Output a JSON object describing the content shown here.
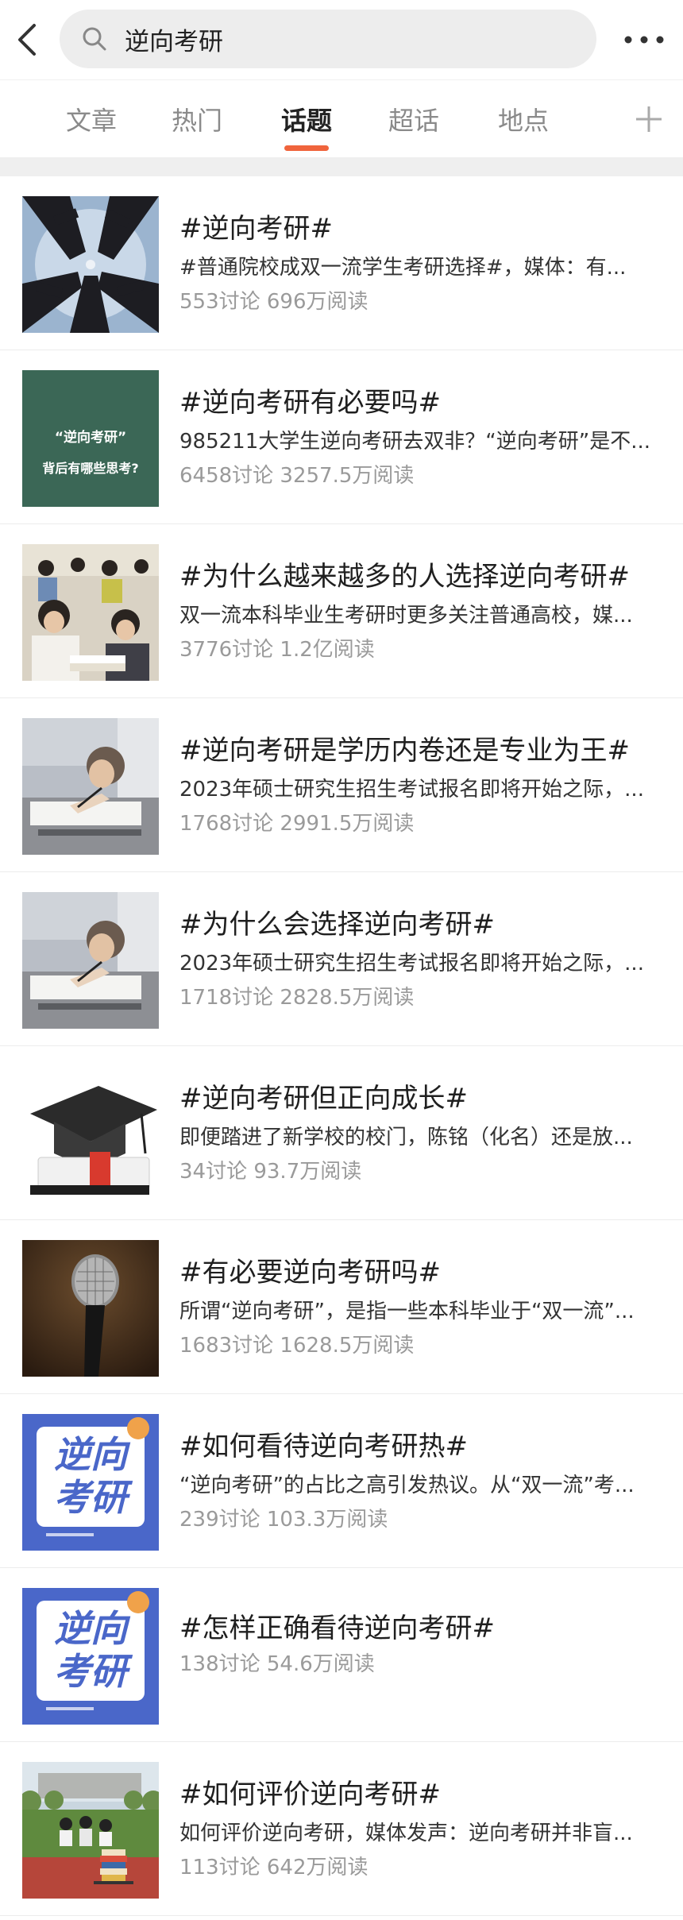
{
  "search": {
    "query": "逆向考研"
  },
  "tabs": [
    {
      "label": "文章"
    },
    {
      "label": "热门"
    },
    {
      "label": "话题"
    },
    {
      "label": "超话"
    },
    {
      "label": "地点"
    }
  ],
  "topics": [
    {
      "title": "#逆向考研#",
      "desc": "#普通院校成双一流学生考研选择#，媒体：有...",
      "meta": "553讨论 696万阅读"
    },
    {
      "title": "#逆向考研有必要吗#",
      "desc": "985211大学生逆向考研去双非？“逆向考研”是不...",
      "meta": "6458讨论 3257.5万阅读",
      "thumb_text": [
        "“逆向考研”",
        "背后有哪些思考?"
      ]
    },
    {
      "title": "#为什么越来越多的人选择逆向考研#",
      "desc": "双一流本科毕业生考研时更多关注普通高校，媒...",
      "meta": "3776讨论 1.2亿阅读"
    },
    {
      "title": "#逆向考研是学历内卷还是专业为王#",
      "desc": "2023年硕士研究生招生考试报名即将开始之际，...",
      "meta": "1768讨论 2991.5万阅读"
    },
    {
      "title": "#为什么会选择逆向考研#",
      "desc": "2023年硕士研究生招生考试报名即将开始之际，...",
      "meta": "1718讨论 2828.5万阅读"
    },
    {
      "title": "#逆向考研但正向成长#",
      "desc": "即便踏进了新学校的校门，陈铭（化名）还是放...",
      "meta": "34讨论 93.7万阅读"
    },
    {
      "title": "#有必要逆向考研吗#",
      "desc": "所谓“逆向考研”，是指一些本科毕业于“双一流”...",
      "meta": "1683讨论 1628.5万阅读"
    },
    {
      "title": "#如何看待逆向考研热#",
      "desc": "“逆向考研”的占比之高引发热议。从“双一流”考...",
      "meta": "239讨论 103.3万阅读",
      "thumb_text": [
        "逆向",
        "考研"
      ]
    },
    {
      "title": "#怎样正确看待逆向考研#",
      "desc": "",
      "meta": "138讨论 54.6万阅读",
      "thumb_text": [
        "逆向",
        "考研"
      ]
    },
    {
      "title": "#如何评价逆向考研#",
      "desc": "如何评价逆向考研，媒体发声：逆向考研并非盲...",
      "meta": "113讨论 642万阅读"
    }
  ],
  "colors": {
    "accent": "#f0643c",
    "logo_blue": "#4a67c9",
    "green_board": "#3e6b5a"
  }
}
